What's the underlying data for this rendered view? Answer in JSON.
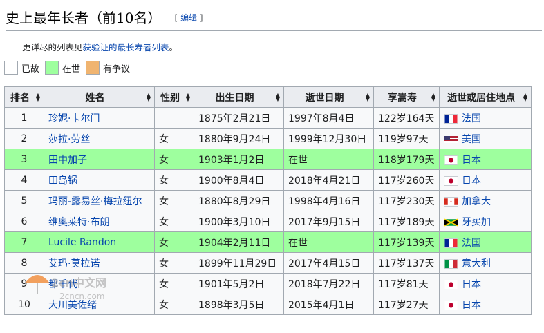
{
  "heading": {
    "title": "史上最年长者（前10名）",
    "edit_open": "[ ",
    "edit_label": "编辑",
    "edit_close": " ]"
  },
  "hatnote": {
    "prefix": "更详尽的列表见",
    "link": "获验证的最长寿者列表",
    "suffix": "。"
  },
  "legend": [
    {
      "label": "已故",
      "color": "#ffffff"
    },
    {
      "label": "在世",
      "color": "#9eff9e"
    },
    {
      "label": "有争议",
      "color": "#f0b470"
    }
  ],
  "table": {
    "headers": [
      "排名",
      "姓名",
      "性别",
      "出生日期",
      "逝世日期",
      "享嵩寿",
      "逝世或居住地点"
    ],
    "rows": [
      {
        "rank": "1",
        "name": "珍妮·卡尔门",
        "sex": "",
        "birth": "1875年2月21日",
        "death": "1997年8月4日",
        "age": "122岁164天",
        "place": "法国",
        "flag": "france-flag-icon",
        "alive": false
      },
      {
        "rank": "2",
        "name": "莎拉·劳丝",
        "sex": "女",
        "birth": "1880年9月24日",
        "death": "1999年12月30日",
        "age": "119岁97天",
        "place": "美国",
        "flag": "usa-flag-icon",
        "alive": false
      },
      {
        "rank": "3",
        "name": "田中加子",
        "sex": "女",
        "birth": "1903年1月2日",
        "death": "在世",
        "age": "118岁179天",
        "place": "日本",
        "flag": "japan-flag-icon",
        "alive": true
      },
      {
        "rank": "4",
        "name": "田岛锅",
        "sex": "女",
        "birth": "1900年8月4日",
        "death": "2018年4月21日",
        "age": "117岁260天",
        "place": "日本",
        "flag": "japan-flag-icon",
        "alive": false
      },
      {
        "rank": "5",
        "name": "玛丽-露易丝·梅拉纽尔",
        "sex": "女",
        "birth": "1880年8月29日",
        "death": "1998年4月16日",
        "age": "117岁230天",
        "place": "加拿大",
        "flag": "canada-flag-icon",
        "alive": false
      },
      {
        "rank": "6",
        "name": "维奥莱特·布朗",
        "sex": "女",
        "birth": "1900年3月10日",
        "death": "2017年9月15日",
        "age": "117岁189天",
        "place": "牙买加",
        "flag": "jamaica-flag-icon",
        "alive": false
      },
      {
        "rank": "7",
        "name": "Lucile Randon",
        "sex": "女",
        "birth": "1904年2月11日",
        "death": "在世",
        "age": "117岁139天",
        "place": "法国",
        "flag": "france-flag-icon",
        "alive": true
      },
      {
        "rank": "8",
        "name": "艾玛·莫拉诺",
        "sex": "女",
        "birth": "1899年11月29日",
        "death": "2017年4月15日",
        "age": "117岁137天",
        "place": "意大利",
        "flag": "italy-flag-icon",
        "alive": false
      },
      {
        "rank": "9",
        "name": "都千代",
        "sex": "女",
        "birth": "1901年5月2日",
        "death": "2018年7月22日",
        "age": "117岁81天",
        "place": "日本",
        "flag": "japan-flag-icon",
        "alive": false
      },
      {
        "rank": "10",
        "name": "大川美佐绪",
        "sex": "女",
        "birth": "1898年3月5日",
        "death": "2015年4月1日",
        "age": "117岁27天",
        "place": "日本",
        "flag": "japan-flag-icon",
        "alive": false
      }
    ]
  },
  "watermark": {
    "text": "2cn中文网",
    "sub": "2cncn.com"
  }
}
